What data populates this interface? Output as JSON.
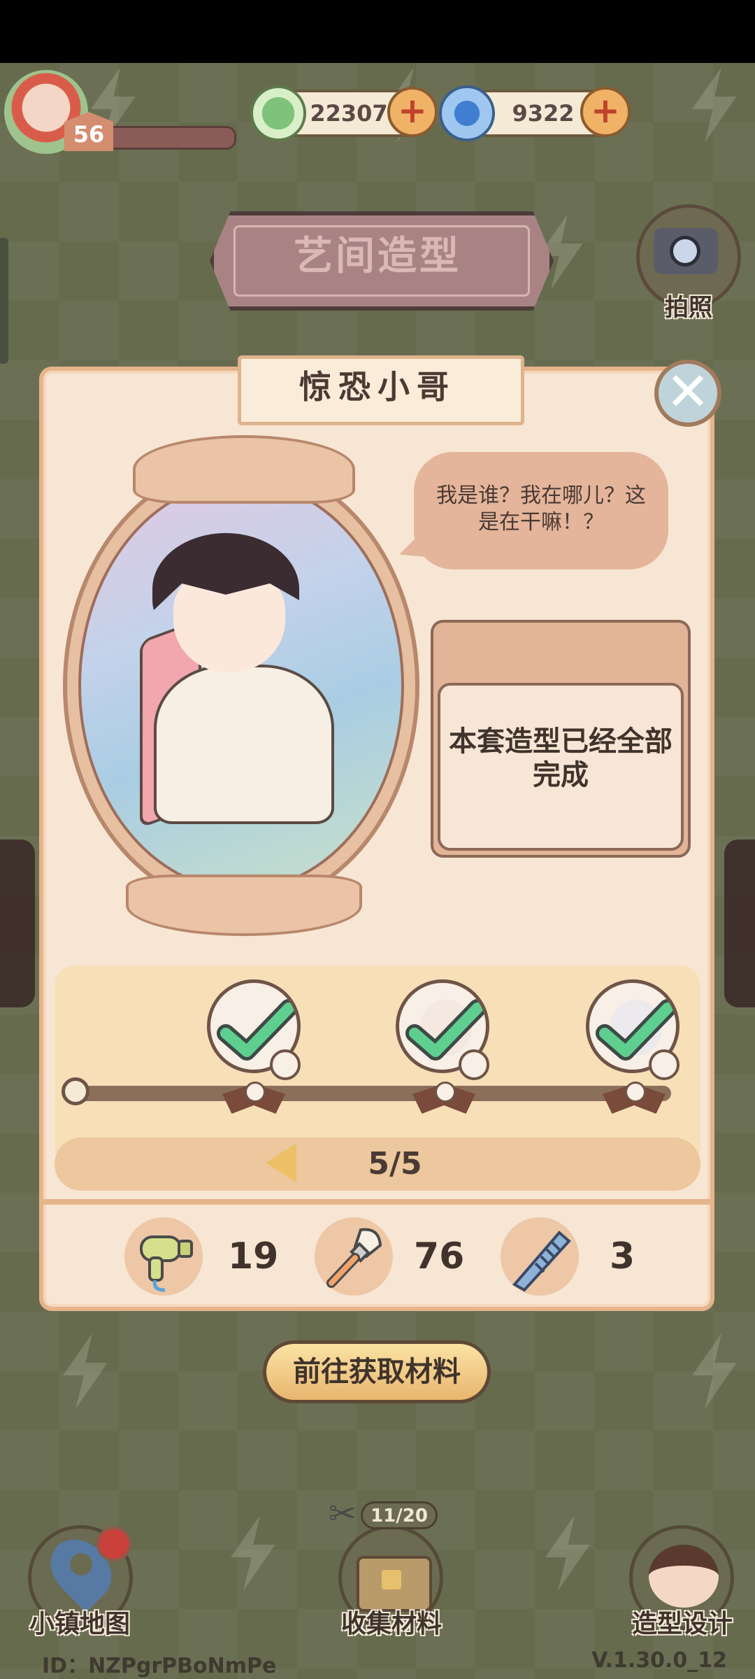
{
  "top_bar": {
    "level": "56",
    "currency_green": "22307",
    "currency_blue": "9322",
    "plus_symbol": "+"
  },
  "header": {
    "title": "艺间造型",
    "camera_label": "拍照"
  },
  "card": {
    "character_name": "惊恐小哥",
    "speech": "我是谁？我在哪儿？这是在干嘛！？",
    "status_text": "本套造型已经全部完成",
    "close_symbol": "✕",
    "progress_text": "5/5",
    "progress_fraction": 1.0,
    "steps_completed": [
      true,
      true,
      true
    ]
  },
  "tools": [
    {
      "icon": "hair-dryer-icon",
      "value": "19"
    },
    {
      "icon": "makeup-brush-icon",
      "value": "76"
    },
    {
      "icon": "comb-icon",
      "value": "3"
    }
  ],
  "action_button": "前往获取材料",
  "bottom_nav": {
    "map_label": "小镇地图",
    "collect_label": "收集材料",
    "collect_counter": "11/20",
    "design_label": "造型设计"
  },
  "footer": {
    "id_text": "ID：NZPgrPBoNmPe",
    "version": "V.1.30.0_12"
  },
  "colors": {
    "background": "#666b4e",
    "card": "#f7e6d3",
    "accent": "#e8b56e",
    "check": "#5fcf8f"
  }
}
